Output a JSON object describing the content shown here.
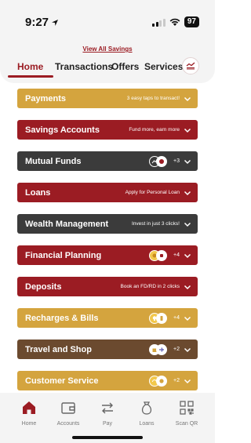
{
  "status_bar": {
    "time": "9:27",
    "battery": "97"
  },
  "view_all_label": "View All Savings",
  "tabs": [
    {
      "label": "Home",
      "active": true
    },
    {
      "label": "Transactions",
      "active": false
    },
    {
      "label": "Offers",
      "active": false
    },
    {
      "label": "Services",
      "active": false
    }
  ],
  "cards": [
    {
      "title": "Payments",
      "subtitle": "3 easy taps to transact!",
      "color": "#d4a43e"
    },
    {
      "title": "Savings Accounts",
      "subtitle": "Fund more, earn more",
      "color": "#9b1c23"
    },
    {
      "title": "Mutual Funds",
      "badge_count": "+3",
      "color": "#3b3b3b"
    },
    {
      "title": "Loans",
      "subtitle": "Apply for Personal Loan",
      "color": "#9b1c23"
    },
    {
      "title": "Wealth Management",
      "subtitle": "Invest in just 3 clicks!",
      "color": "#3b3b3b"
    },
    {
      "title": "Financial Planning",
      "badge_count": "+4",
      "color": "#9b1c23"
    },
    {
      "title": "Deposits",
      "subtitle": "Book an FD/RD in 2 clicks",
      "color": "#9b1c23"
    },
    {
      "title": "Recharges & Bills",
      "badge_count": "+4",
      "color": "#d4a43e"
    },
    {
      "title": "Travel and Shop",
      "badge_count": "+2",
      "color": "#6b4a2f"
    },
    {
      "title": "Customer Service",
      "badge_count": "+2",
      "color": "#d4a43e"
    }
  ],
  "bottom_nav": [
    {
      "label": "Home",
      "icon": "home-icon",
      "active": true
    },
    {
      "label": "Accounts",
      "icon": "wallet-icon",
      "active": false
    },
    {
      "label": "Pay",
      "icon": "transfer-icon",
      "active": false
    },
    {
      "label": "Loans",
      "icon": "money-bag-icon",
      "active": false
    },
    {
      "label": "Scan QR",
      "icon": "qr-icon",
      "active": false
    }
  ],
  "colors": {
    "accent": "#9b1c23",
    "gold": "#d4a43e",
    "dark": "#3b3b3b",
    "brown": "#6b4a2f"
  }
}
